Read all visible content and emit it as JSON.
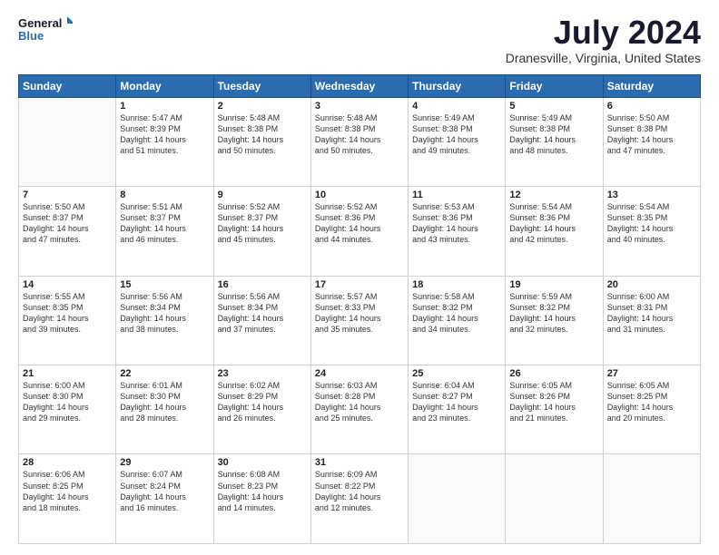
{
  "logo": {
    "line1": "General",
    "line2": "Blue"
  },
  "title": "July 2024",
  "location": "Dranesville, Virginia, United States",
  "days_of_week": [
    "Sunday",
    "Monday",
    "Tuesday",
    "Wednesday",
    "Thursday",
    "Friday",
    "Saturday"
  ],
  "weeks": [
    [
      {
        "day": "",
        "info": ""
      },
      {
        "day": "1",
        "info": "Sunrise: 5:47 AM\nSunset: 8:39 PM\nDaylight: 14 hours\nand 51 minutes."
      },
      {
        "day": "2",
        "info": "Sunrise: 5:48 AM\nSunset: 8:38 PM\nDaylight: 14 hours\nand 50 minutes."
      },
      {
        "day": "3",
        "info": "Sunrise: 5:48 AM\nSunset: 8:38 PM\nDaylight: 14 hours\nand 50 minutes."
      },
      {
        "day": "4",
        "info": "Sunrise: 5:49 AM\nSunset: 8:38 PM\nDaylight: 14 hours\nand 49 minutes."
      },
      {
        "day": "5",
        "info": "Sunrise: 5:49 AM\nSunset: 8:38 PM\nDaylight: 14 hours\nand 48 minutes."
      },
      {
        "day": "6",
        "info": "Sunrise: 5:50 AM\nSunset: 8:38 PM\nDaylight: 14 hours\nand 47 minutes."
      }
    ],
    [
      {
        "day": "7",
        "info": "Sunrise: 5:50 AM\nSunset: 8:37 PM\nDaylight: 14 hours\nand 47 minutes."
      },
      {
        "day": "8",
        "info": "Sunrise: 5:51 AM\nSunset: 8:37 PM\nDaylight: 14 hours\nand 46 minutes."
      },
      {
        "day": "9",
        "info": "Sunrise: 5:52 AM\nSunset: 8:37 PM\nDaylight: 14 hours\nand 45 minutes."
      },
      {
        "day": "10",
        "info": "Sunrise: 5:52 AM\nSunset: 8:36 PM\nDaylight: 14 hours\nand 44 minutes."
      },
      {
        "day": "11",
        "info": "Sunrise: 5:53 AM\nSunset: 8:36 PM\nDaylight: 14 hours\nand 43 minutes."
      },
      {
        "day": "12",
        "info": "Sunrise: 5:54 AM\nSunset: 8:36 PM\nDaylight: 14 hours\nand 42 minutes."
      },
      {
        "day": "13",
        "info": "Sunrise: 5:54 AM\nSunset: 8:35 PM\nDaylight: 14 hours\nand 40 minutes."
      }
    ],
    [
      {
        "day": "14",
        "info": "Sunrise: 5:55 AM\nSunset: 8:35 PM\nDaylight: 14 hours\nand 39 minutes."
      },
      {
        "day": "15",
        "info": "Sunrise: 5:56 AM\nSunset: 8:34 PM\nDaylight: 14 hours\nand 38 minutes."
      },
      {
        "day": "16",
        "info": "Sunrise: 5:56 AM\nSunset: 8:34 PM\nDaylight: 14 hours\nand 37 minutes."
      },
      {
        "day": "17",
        "info": "Sunrise: 5:57 AM\nSunset: 8:33 PM\nDaylight: 14 hours\nand 35 minutes."
      },
      {
        "day": "18",
        "info": "Sunrise: 5:58 AM\nSunset: 8:32 PM\nDaylight: 14 hours\nand 34 minutes."
      },
      {
        "day": "19",
        "info": "Sunrise: 5:59 AM\nSunset: 8:32 PM\nDaylight: 14 hours\nand 32 minutes."
      },
      {
        "day": "20",
        "info": "Sunrise: 6:00 AM\nSunset: 8:31 PM\nDaylight: 14 hours\nand 31 minutes."
      }
    ],
    [
      {
        "day": "21",
        "info": "Sunrise: 6:00 AM\nSunset: 8:30 PM\nDaylight: 14 hours\nand 29 minutes."
      },
      {
        "day": "22",
        "info": "Sunrise: 6:01 AM\nSunset: 8:30 PM\nDaylight: 14 hours\nand 28 minutes."
      },
      {
        "day": "23",
        "info": "Sunrise: 6:02 AM\nSunset: 8:29 PM\nDaylight: 14 hours\nand 26 minutes."
      },
      {
        "day": "24",
        "info": "Sunrise: 6:03 AM\nSunset: 8:28 PM\nDaylight: 14 hours\nand 25 minutes."
      },
      {
        "day": "25",
        "info": "Sunrise: 6:04 AM\nSunset: 8:27 PM\nDaylight: 14 hours\nand 23 minutes."
      },
      {
        "day": "26",
        "info": "Sunrise: 6:05 AM\nSunset: 8:26 PM\nDaylight: 14 hours\nand 21 minutes."
      },
      {
        "day": "27",
        "info": "Sunrise: 6:05 AM\nSunset: 8:25 PM\nDaylight: 14 hours\nand 20 minutes."
      }
    ],
    [
      {
        "day": "28",
        "info": "Sunrise: 6:06 AM\nSunset: 8:25 PM\nDaylight: 14 hours\nand 18 minutes."
      },
      {
        "day": "29",
        "info": "Sunrise: 6:07 AM\nSunset: 8:24 PM\nDaylight: 14 hours\nand 16 minutes."
      },
      {
        "day": "30",
        "info": "Sunrise: 6:08 AM\nSunset: 8:23 PM\nDaylight: 14 hours\nand 14 minutes."
      },
      {
        "day": "31",
        "info": "Sunrise: 6:09 AM\nSunset: 8:22 PM\nDaylight: 14 hours\nand 12 minutes."
      },
      {
        "day": "",
        "info": ""
      },
      {
        "day": "",
        "info": ""
      },
      {
        "day": "",
        "info": ""
      }
    ]
  ]
}
